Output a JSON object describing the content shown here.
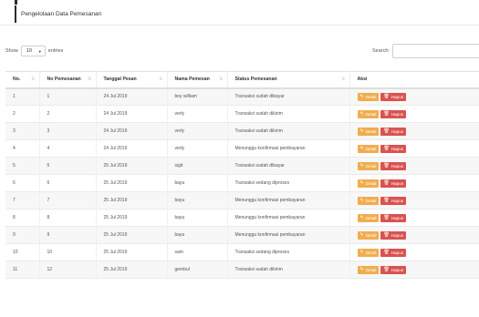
{
  "page": {
    "title": "Pengelolaan Data Pemesanan"
  },
  "length_control": {
    "prefix": "Show",
    "value": "10",
    "suffix": "entries"
  },
  "search": {
    "label": "Search:",
    "value": ""
  },
  "table": {
    "headers": [
      "No.",
      "No Pemesanan",
      "Tanggal Pesan",
      "Nama Pemesan",
      "Status Pemesanan",
      "Aksi"
    ],
    "rows": [
      [
        "1",
        "1",
        "24 Jul 2019",
        "boy william",
        "Transaksi sudah dibayar"
      ],
      [
        "2",
        "2",
        "24 Jul 2019",
        "verly",
        "Transaksi sudah dikirim"
      ],
      [
        "3",
        "3",
        "24 Jul 2019",
        "verly",
        "Transaksi sudah dikirim"
      ],
      [
        "4",
        "4",
        "24 Jul 2019",
        "verly",
        "Menunggu konfirmasi pembayaran"
      ],
      [
        "5",
        "5",
        "25 Jul 2019",
        "sigit",
        "Transaksi sudah dibayar"
      ],
      [
        "6",
        "6",
        "25 Jul 2019",
        "bayu",
        "Transaksi sedang diproses"
      ],
      [
        "7",
        "7",
        "25 Jul 2019",
        "bayu",
        "Menunggu konfirmasi pembayaran"
      ],
      [
        "8",
        "8",
        "25 Jul 2019",
        "bayu",
        "Menunggu konfirmasi pembayaran"
      ],
      [
        "9",
        "9",
        "25 Jul 2019",
        "bayu",
        "Menunggu konfirmasi pembayaran"
      ],
      [
        "10",
        "10",
        "25 Jul 2019",
        "sam",
        "Transaksi sedang diproses"
      ],
      [
        "11",
        "12",
        "25 Jul 2019",
        "gembul",
        "Transaksi sudah dikirim"
      ]
    ],
    "actions": {
      "detail_label": "Detail",
      "detail_icon": "edit-icon",
      "hapus_label": "Hapus",
      "hapus_icon": "trash-icon"
    }
  },
  "colors": {
    "detail_button": "#f0ad4e",
    "hapus_button": "#d9534f",
    "accent_bar": "#2b2b2b"
  }
}
